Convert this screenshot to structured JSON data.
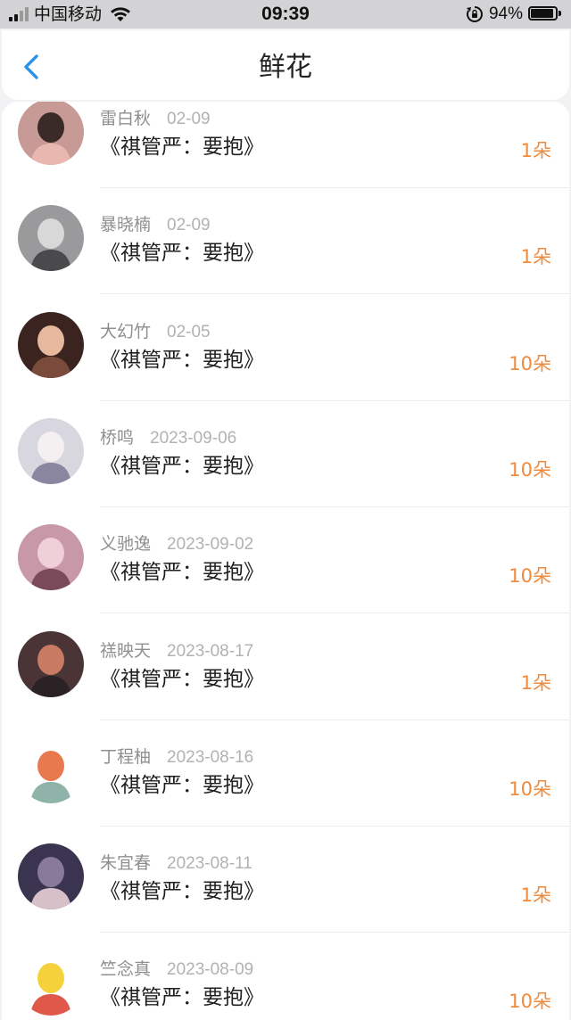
{
  "status_bar": {
    "carrier": "中国移动",
    "time": "09:39",
    "battery": "94%"
  },
  "header": {
    "title": "鲜花"
  },
  "items": [
    {
      "name": "雷白秋",
      "date": "02-09",
      "book": "《祺管严：要抱》",
      "count": "1朵",
      "avatar_colors": [
        "#c89a95",
        "#3a2a28",
        "#e8b8b0"
      ]
    },
    {
      "name": "暴晓楠",
      "date": "02-09",
      "book": "《祺管严：要抱》",
      "count": "1朵",
      "avatar_colors": [
        "#9a9a9c",
        "#d8d8d8",
        "#4a4a4c"
      ]
    },
    {
      "name": "大幻竹",
      "date": "02-05",
      "book": "《祺管严：要抱》",
      "count": "10朵",
      "avatar_colors": [
        "#3b2320",
        "#e6b89e",
        "#7a4a3a"
      ]
    },
    {
      "name": "桥鸣",
      "date": "2023-09-06",
      "book": "《祺管严：要抱》",
      "count": "10朵",
      "avatar_colors": [
        "#d8d6de",
        "#f4f0f2",
        "#8a86a0"
      ]
    },
    {
      "name": "义驰逸",
      "date": "2023-09-02",
      "book": "《祺管严：要抱》",
      "count": "10朵",
      "avatar_colors": [
        "#c898a8",
        "#f0d0d8",
        "#7a4a5a"
      ]
    },
    {
      "name": "禚映天",
      "date": "2023-08-17",
      "book": "《祺管严：要抱》",
      "count": "1朵",
      "avatar_colors": [
        "#4a3436",
        "#c87a62",
        "#2a2224"
      ]
    },
    {
      "name": "丁程柚",
      "date": "2023-08-16",
      "book": "《祺管严：要抱》",
      "count": "10朵",
      "avatar_colors": [
        "#ffffff",
        "#e8794e",
        "#8fb3a8"
      ]
    },
    {
      "name": "朱宜春",
      "date": "2023-08-11",
      "book": "《祺管严：要抱》",
      "count": "1朵",
      "avatar_colors": [
        "#3a3450",
        "#8a7a9a",
        "#d8c0c8"
      ]
    },
    {
      "name": "竺念真",
      "date": "2023-08-09",
      "book": "《祺管严：要抱》",
      "count": "10朵",
      "avatar_colors": [
        "#ffffff",
        "#f5d23c",
        "#e0584a"
      ]
    }
  ]
}
